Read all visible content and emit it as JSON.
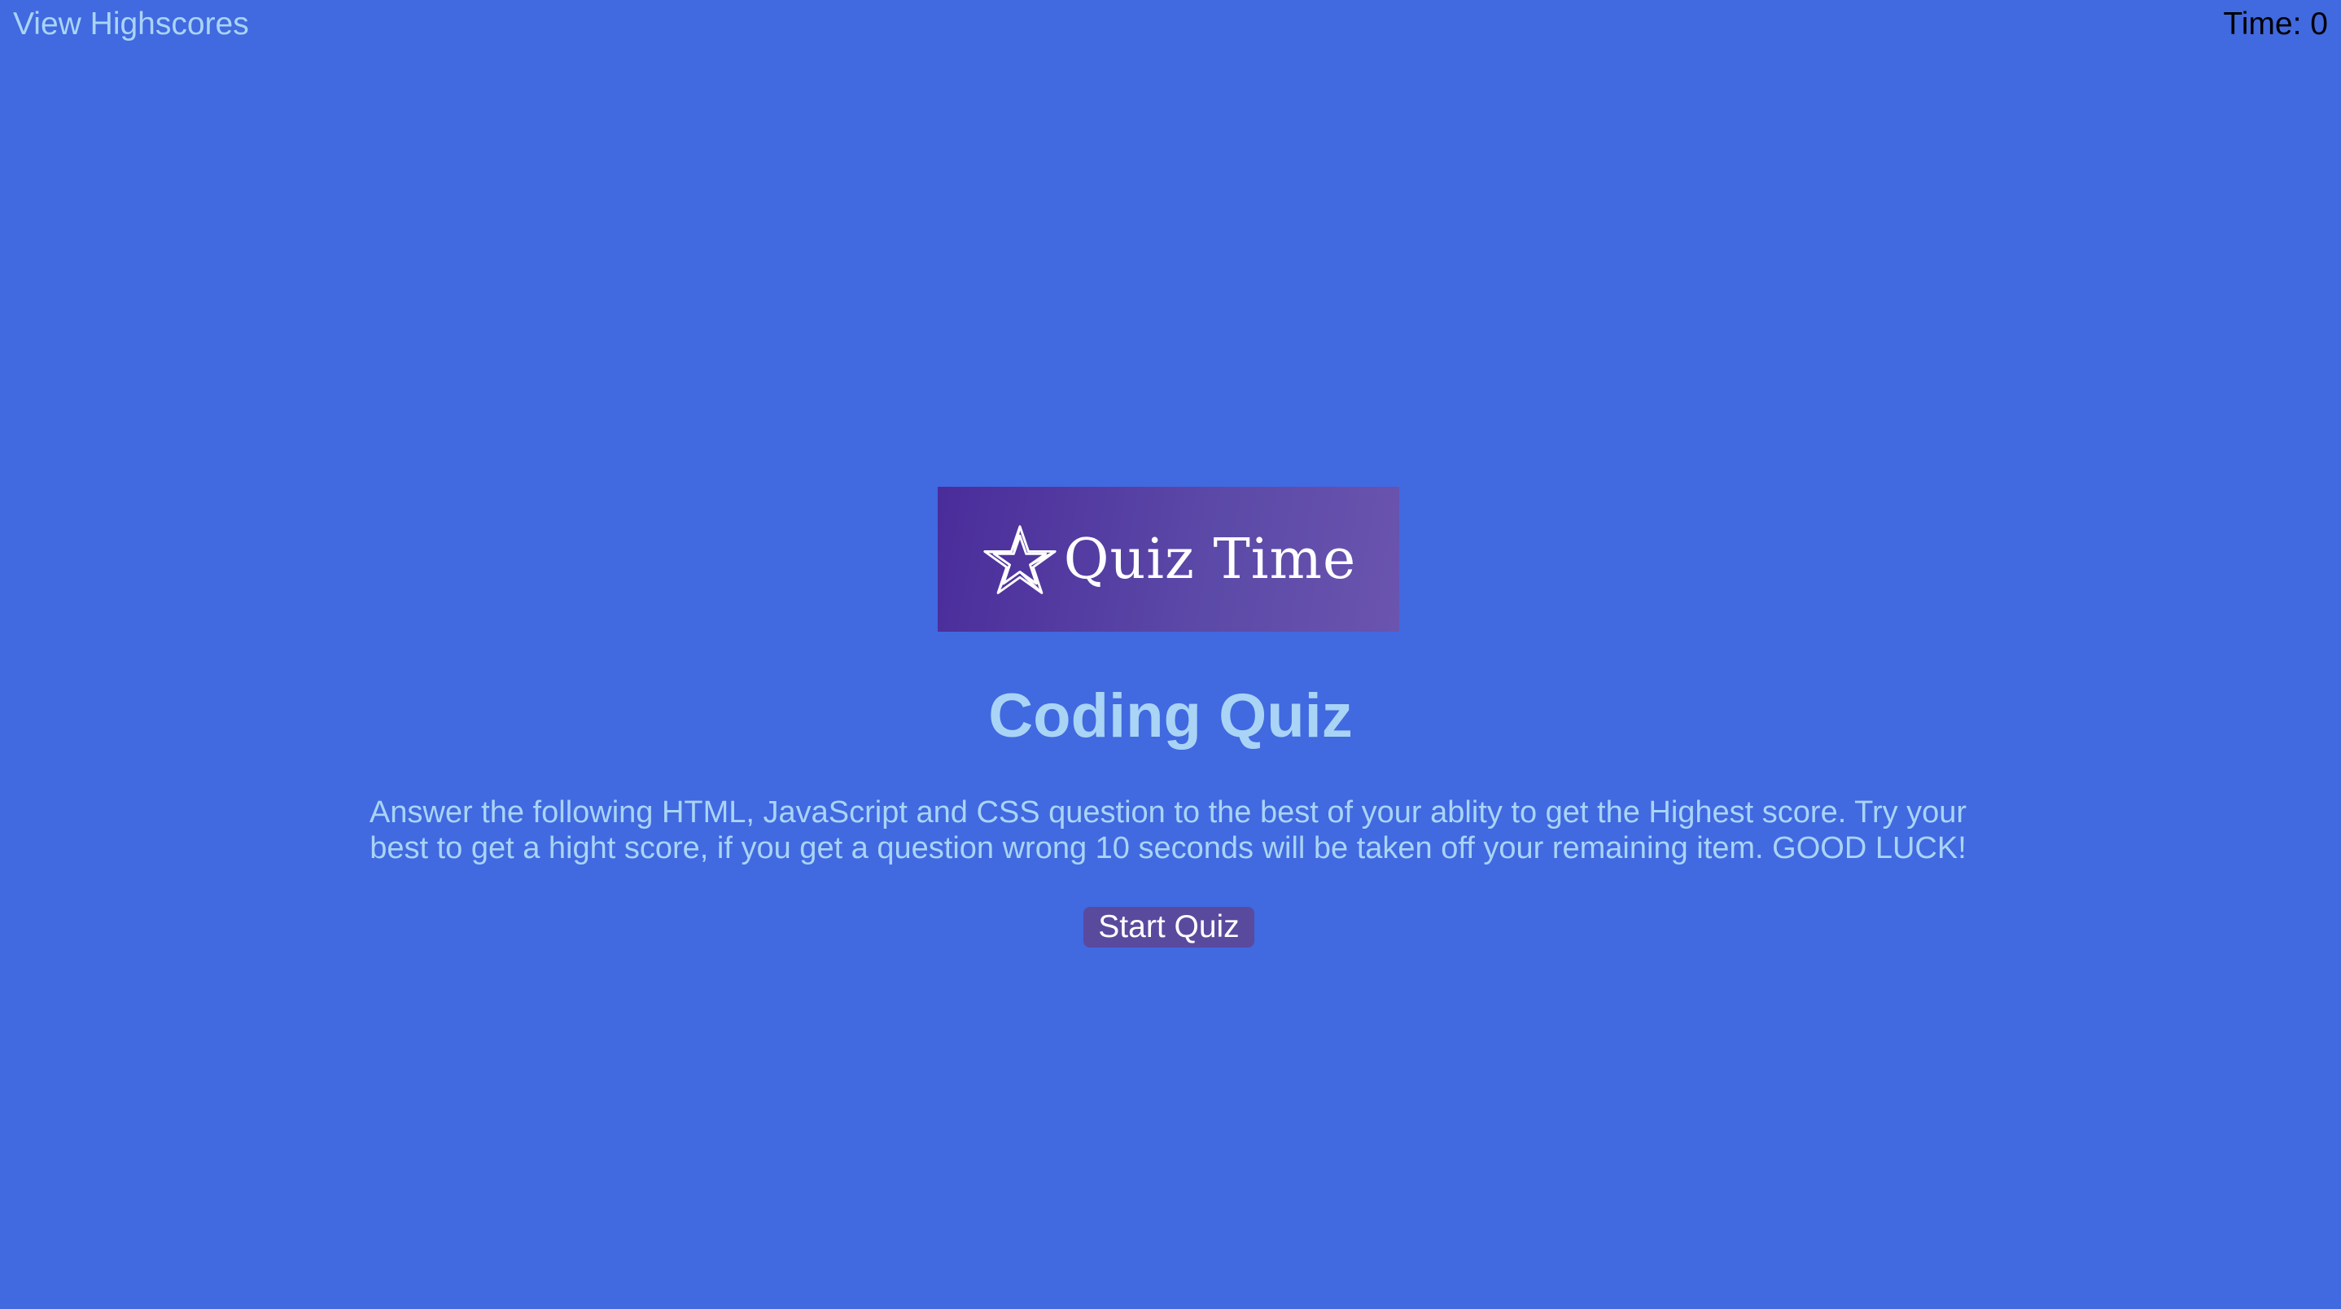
{
  "header": {
    "highscores_link": "View Highscores",
    "timer_label": "Time:",
    "timer_value": "0"
  },
  "logo": {
    "text": "Quiz Time",
    "icon": "star-icon"
  },
  "main": {
    "title": "Coding Quiz",
    "description": "Answer the following HTML, JavaScript and CSS question to the best of your ablity to get the Highest score. Try your best to get a hight score, if you get a question wrong 10 seconds will be taken off your remaining item. GOOD LUCK!",
    "start_button": "Start Quiz"
  },
  "colors": {
    "background": "#4169e0",
    "accent_text": "#a9d4f5",
    "button": "#5a4a9e",
    "logo_background": "#4a2c9a"
  }
}
